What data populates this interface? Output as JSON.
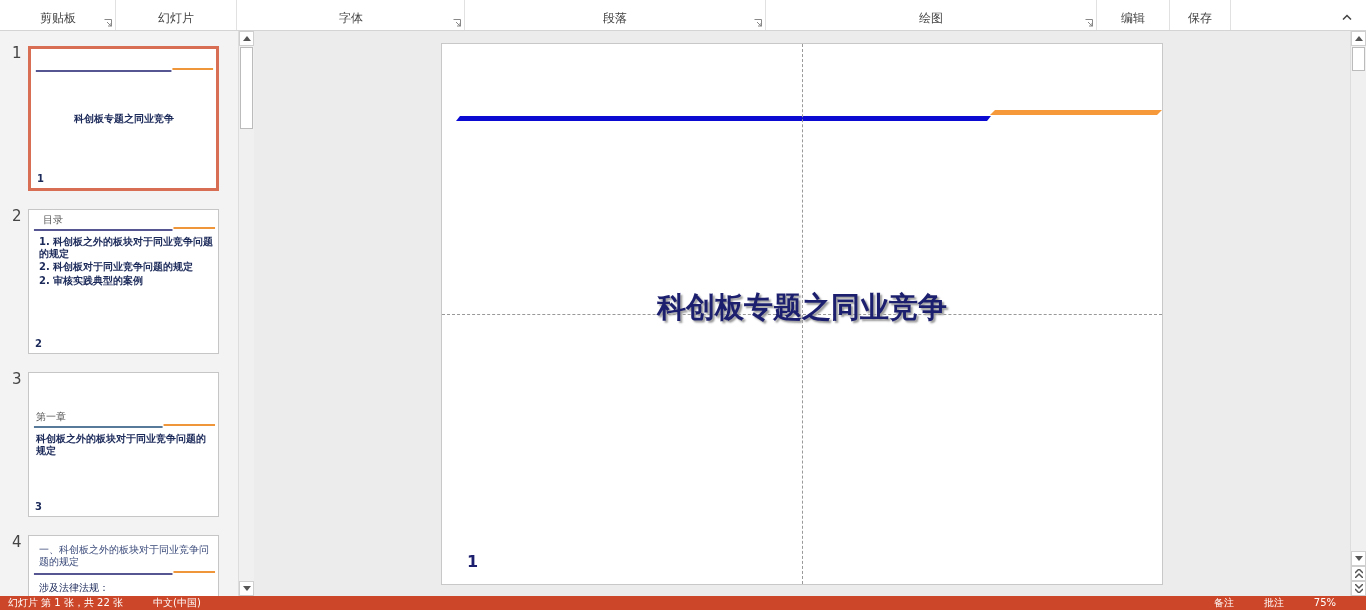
{
  "ribbon_groups": [
    {
      "label": "剪贴板",
      "launcher": true
    },
    {
      "label": "幻灯片",
      "launcher": false
    },
    {
      "label": "字体",
      "launcher": true
    },
    {
      "label": "段落",
      "launcher": true
    },
    {
      "label": "绘图",
      "launcher": true
    },
    {
      "label": "编辑",
      "launcher": false
    },
    {
      "label": "保存",
      "launcher": false
    }
  ],
  "slides": [
    {
      "number": "1",
      "selected": true,
      "kind": "title",
      "title": "科创板专题之同业竞争",
      "page": "1"
    },
    {
      "number": "2",
      "selected": false,
      "kind": "toc",
      "heading": "目录",
      "items": [
        "1. 科创板之外的板块对于同业竞争问题的规定",
        "2. 科创板对于同业竞争问题的规定",
        "2. 审核实践典型的案例"
      ],
      "page": "2"
    },
    {
      "number": "3",
      "selected": false,
      "kind": "chapter",
      "heading": "第一章",
      "title": "科创板之外的板块对于同业竞争问题的规定",
      "page": "3"
    },
    {
      "number": "4",
      "selected": false,
      "kind": "content",
      "title": "一、科创板之外的板块对于同业竞争问题的规定",
      "lines": [
        "涉及法律法规："
      ]
    }
  ],
  "editor": {
    "title": "科创板专题之同业竞争",
    "page": "1"
  },
  "status_bar": {
    "slide_info": "幻灯片 第 1 张，共 22 张",
    "language": "中文(中国)",
    "notes": "备注",
    "comments": "批注",
    "zoom": "75%"
  }
}
